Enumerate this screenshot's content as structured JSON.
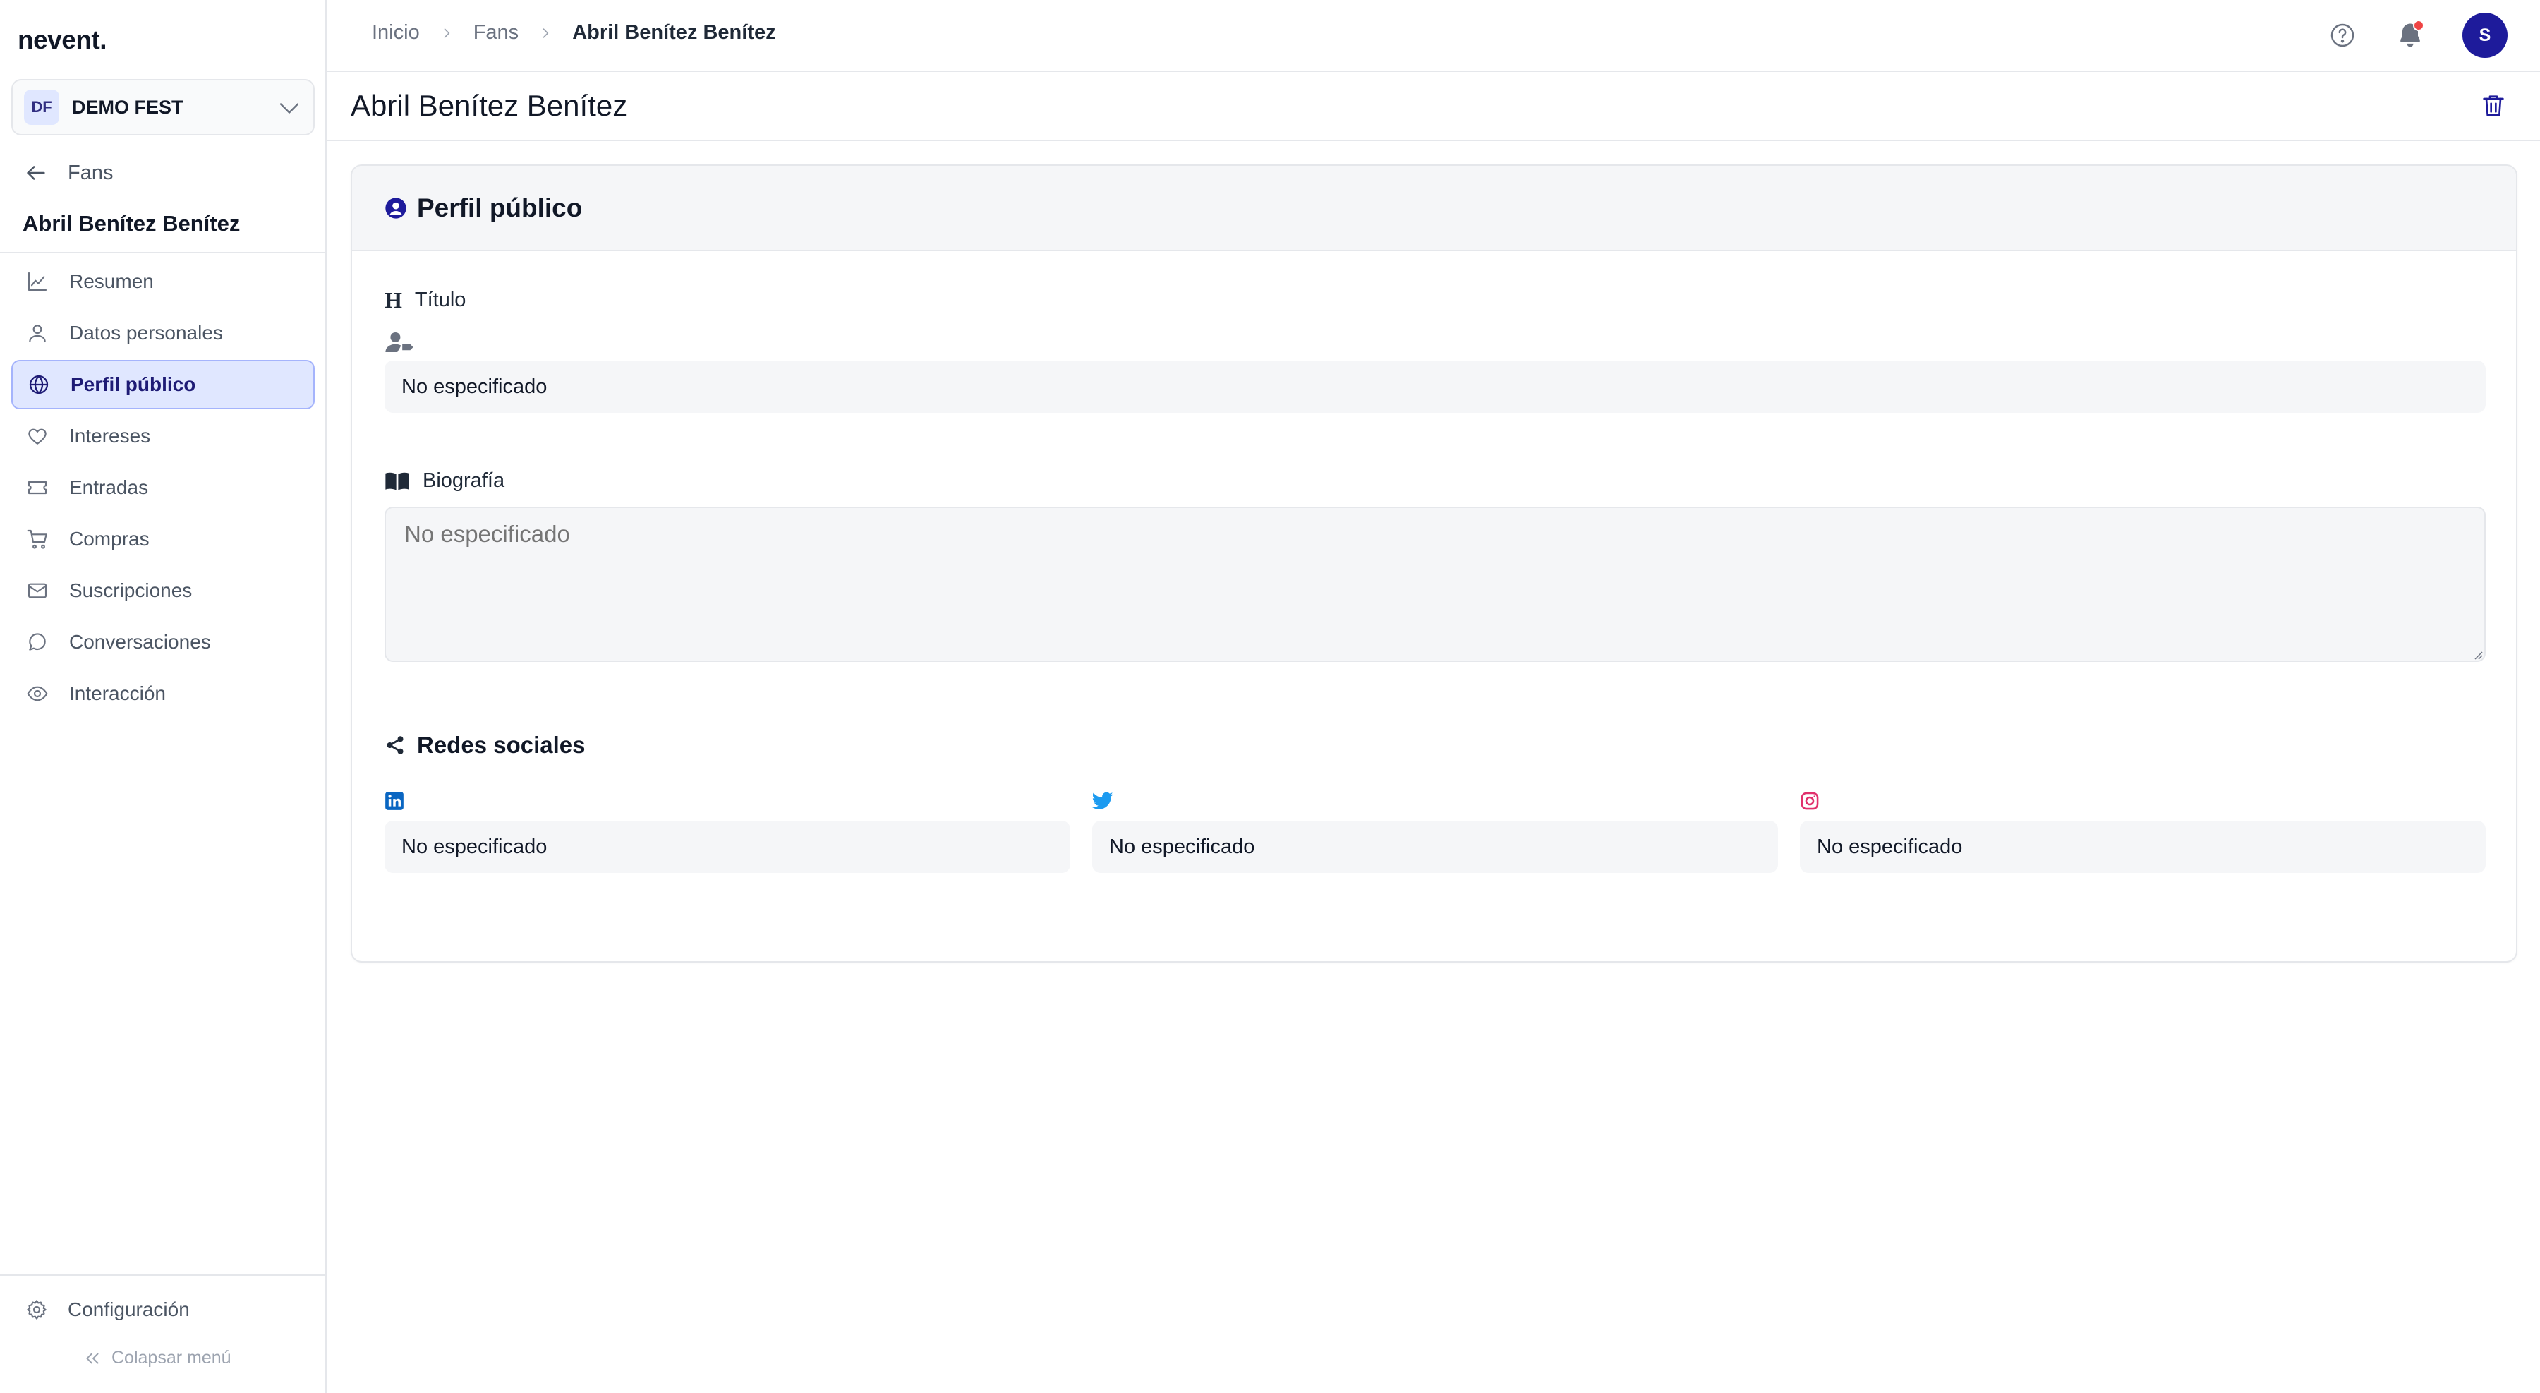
{
  "app": {
    "logo": "nevent."
  },
  "org": {
    "initials": "DF",
    "name": "DEMO FEST"
  },
  "sidebar": {
    "back_label": "Fans",
    "fan_name": "Abril Benítez Benítez",
    "items": [
      {
        "label": "Resumen",
        "icon": "chart-line-icon"
      },
      {
        "label": "Datos personales",
        "icon": "user-icon"
      },
      {
        "label": "Perfil público",
        "icon": "globe-icon",
        "active": true
      },
      {
        "label": "Intereses",
        "icon": "heart-icon"
      },
      {
        "label": "Entradas",
        "icon": "ticket-icon"
      },
      {
        "label": "Compras",
        "icon": "cart-icon"
      },
      {
        "label": "Suscripciones",
        "icon": "mail-icon"
      },
      {
        "label": "Conversaciones",
        "icon": "chat-icon"
      },
      {
        "label": "Interacción",
        "icon": "eye-icon"
      }
    ],
    "config_label": "Configuración",
    "collapse_label": "Colapsar menú"
  },
  "breadcrumb": [
    "Inicio",
    "Fans",
    "Abril Benítez Benítez"
  ],
  "topbar": {
    "avatar_initial": "S",
    "has_notifications": true
  },
  "page": {
    "title": "Abril Benítez Benítez"
  },
  "card": {
    "title": "Perfil público",
    "titulo_label": "Título",
    "titulo_value": "No especificado",
    "bio_label": "Biografía",
    "bio_placeholder": "No especificado",
    "social_title": "Redes sociales",
    "social": [
      {
        "network": "linkedin",
        "value": "No especificado"
      },
      {
        "network": "twitter",
        "value": "No especificado"
      },
      {
        "network": "instagram",
        "value": "No especificado"
      }
    ]
  },
  "colors": {
    "accent": "#1e1b9b",
    "active_bg": "#e0e7ff",
    "linkedin": "#0a66c2",
    "twitter": "#1d9bf0",
    "instagram": "#e1306c",
    "notification_dot": "#ef4444"
  }
}
